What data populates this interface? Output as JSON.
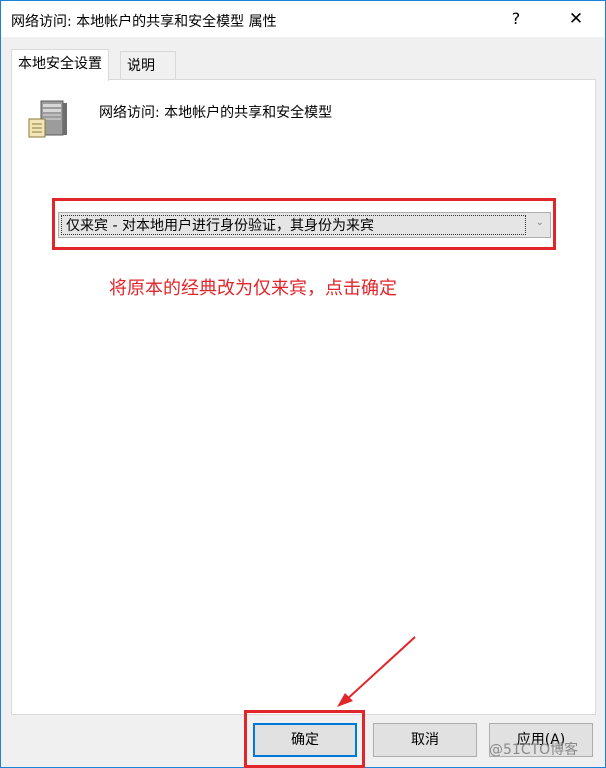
{
  "window": {
    "title": "网络访问: 本地帐户的共享和安全模型 属性",
    "help_glyph": "?",
    "close_glyph": "✕"
  },
  "tabs": [
    {
      "label": "本地安全设置",
      "active": true
    },
    {
      "label": "说明",
      "active": false
    }
  ],
  "policy": {
    "icon": "server-icon",
    "name": "网络访问: 本地帐户的共享和安全模型"
  },
  "dropdown": {
    "selected": "仅来宾 - 对本地用户进行身份验证，其身份为来宾",
    "arrow_glyph": "⌄"
  },
  "annotation": {
    "text": "将原本的经典改为仅来宾，点击确定",
    "color": "#e0262a"
  },
  "buttons": {
    "ok": "确定",
    "cancel": "取消",
    "apply": "应用(A)"
  },
  "watermark": "@51CTO博客",
  "colors": {
    "accent": "#0078d7",
    "annotation_red": "#e0262a"
  }
}
